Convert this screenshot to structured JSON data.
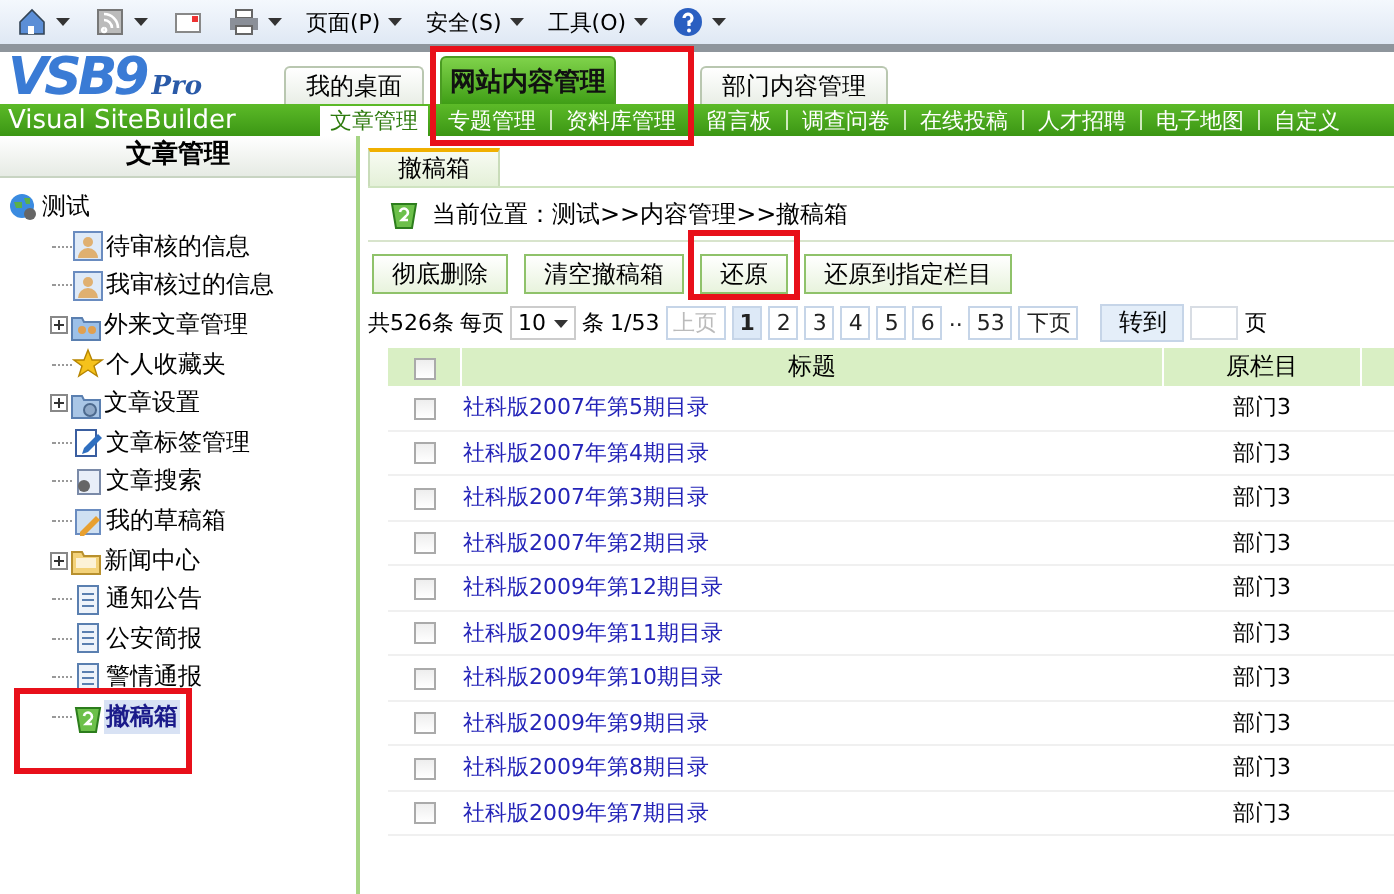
{
  "browser_toolbar": {
    "menus": [
      {
        "label": "页面(P)"
      },
      {
        "label": "安全(S)"
      },
      {
        "label": "工具(O)"
      }
    ]
  },
  "header": {
    "logo": {
      "mark": "VSB9",
      "suffix": "Pro",
      "subtitle": "Visual SiteBuilder"
    },
    "tabs": [
      {
        "label": "我的桌面",
        "selected": false
      },
      {
        "label": "网站内容管理",
        "selected": true
      },
      {
        "label": "部门内容管理",
        "selected": false
      }
    ],
    "nav": [
      {
        "label": "文章管理",
        "selected": true
      },
      {
        "label": "专题管理",
        "selected": false
      },
      {
        "label": "资料库管理",
        "selected": false
      },
      {
        "label": "留言板",
        "selected": false
      },
      {
        "label": "调查问卷",
        "selected": false
      },
      {
        "label": "在线投稿",
        "selected": false
      },
      {
        "label": "人才招聘",
        "selected": false
      },
      {
        "label": "电子地图",
        "selected": false
      },
      {
        "label": "自定义",
        "selected": false
      }
    ]
  },
  "sidebar": {
    "title": "文章管理",
    "tree": [
      {
        "label": "测试",
        "selected": false,
        "children": [
          {
            "label": "待审核的信息",
            "selected": false
          },
          {
            "label": "我审核过的信息",
            "selected": false
          },
          {
            "label": "外来文章管理",
            "selected": false,
            "expanded": false
          },
          {
            "label": "个人收藏夹",
            "selected": false
          },
          {
            "label": "文章设置",
            "selected": false,
            "expanded": false
          },
          {
            "label": "文章标签管理",
            "selected": false
          },
          {
            "label": "文章搜索",
            "selected": false
          },
          {
            "label": "我的草稿箱",
            "selected": false
          },
          {
            "label": "新闻中心",
            "selected": false,
            "expanded": false
          },
          {
            "label": "通知公告",
            "selected": false
          },
          {
            "label": "公安简报",
            "selected": false
          },
          {
            "label": "警情通报",
            "selected": false
          },
          {
            "label": "撤稿箱",
            "selected": true
          }
        ]
      }
    ]
  },
  "main": {
    "tab": "撤稿箱",
    "breadcrumb": "当前位置：测试>>内容管理>>撤稿箱",
    "buttons": [
      "彻底删除",
      "清空撤稿箱",
      "还原",
      "还原到指定栏目"
    ],
    "pagination": {
      "total": "共526条",
      "per_page_label": "每页",
      "per_page": "10",
      "unit": "条",
      "page_info": "1/53",
      "prev": {
        "label": "上页",
        "disabled": true
      },
      "pages": [
        {
          "label": "1",
          "selected": true
        },
        {
          "label": "2",
          "selected": false
        },
        {
          "label": "3",
          "selected": false
        },
        {
          "label": "4",
          "selected": false
        },
        {
          "label": "5",
          "selected": false
        },
        {
          "label": "6",
          "selected": false
        }
      ],
      "ellipsis": "..",
      "last_page": {
        "label": "53",
        "selected": false
      },
      "next": {
        "label": "下页",
        "disabled": false
      },
      "goto": "转到",
      "goto_unit": "页"
    },
    "table": {
      "select_all_checked": false,
      "columns": [
        "标题",
        "原栏目"
      ],
      "rows": [
        {
          "checked": false,
          "title": "社科版2007年第5期目录",
          "column": "部门3"
        },
        {
          "checked": false,
          "title": "社科版2007年第4期目录",
          "column": "部门3"
        },
        {
          "checked": false,
          "title": "社科版2007年第3期目录",
          "column": "部门3"
        },
        {
          "checked": false,
          "title": "社科版2007年第2期目录",
          "column": "部门3"
        },
        {
          "checked": false,
          "title": "社科版2009年第12期目录",
          "column": "部门3"
        },
        {
          "checked": false,
          "title": "社科版2009年第11期目录",
          "column": "部门3"
        },
        {
          "checked": false,
          "title": "社科版2009年第10期目录",
          "column": "部门3"
        },
        {
          "checked": false,
          "title": "社科版2009年第9期目录",
          "column": "部门3"
        },
        {
          "checked": false,
          "title": "社科版2009年第8期目录",
          "column": "部门3"
        },
        {
          "checked": false,
          "title": "社科版2009年第7期目录",
          "column": "部门3"
        }
      ]
    }
  }
}
